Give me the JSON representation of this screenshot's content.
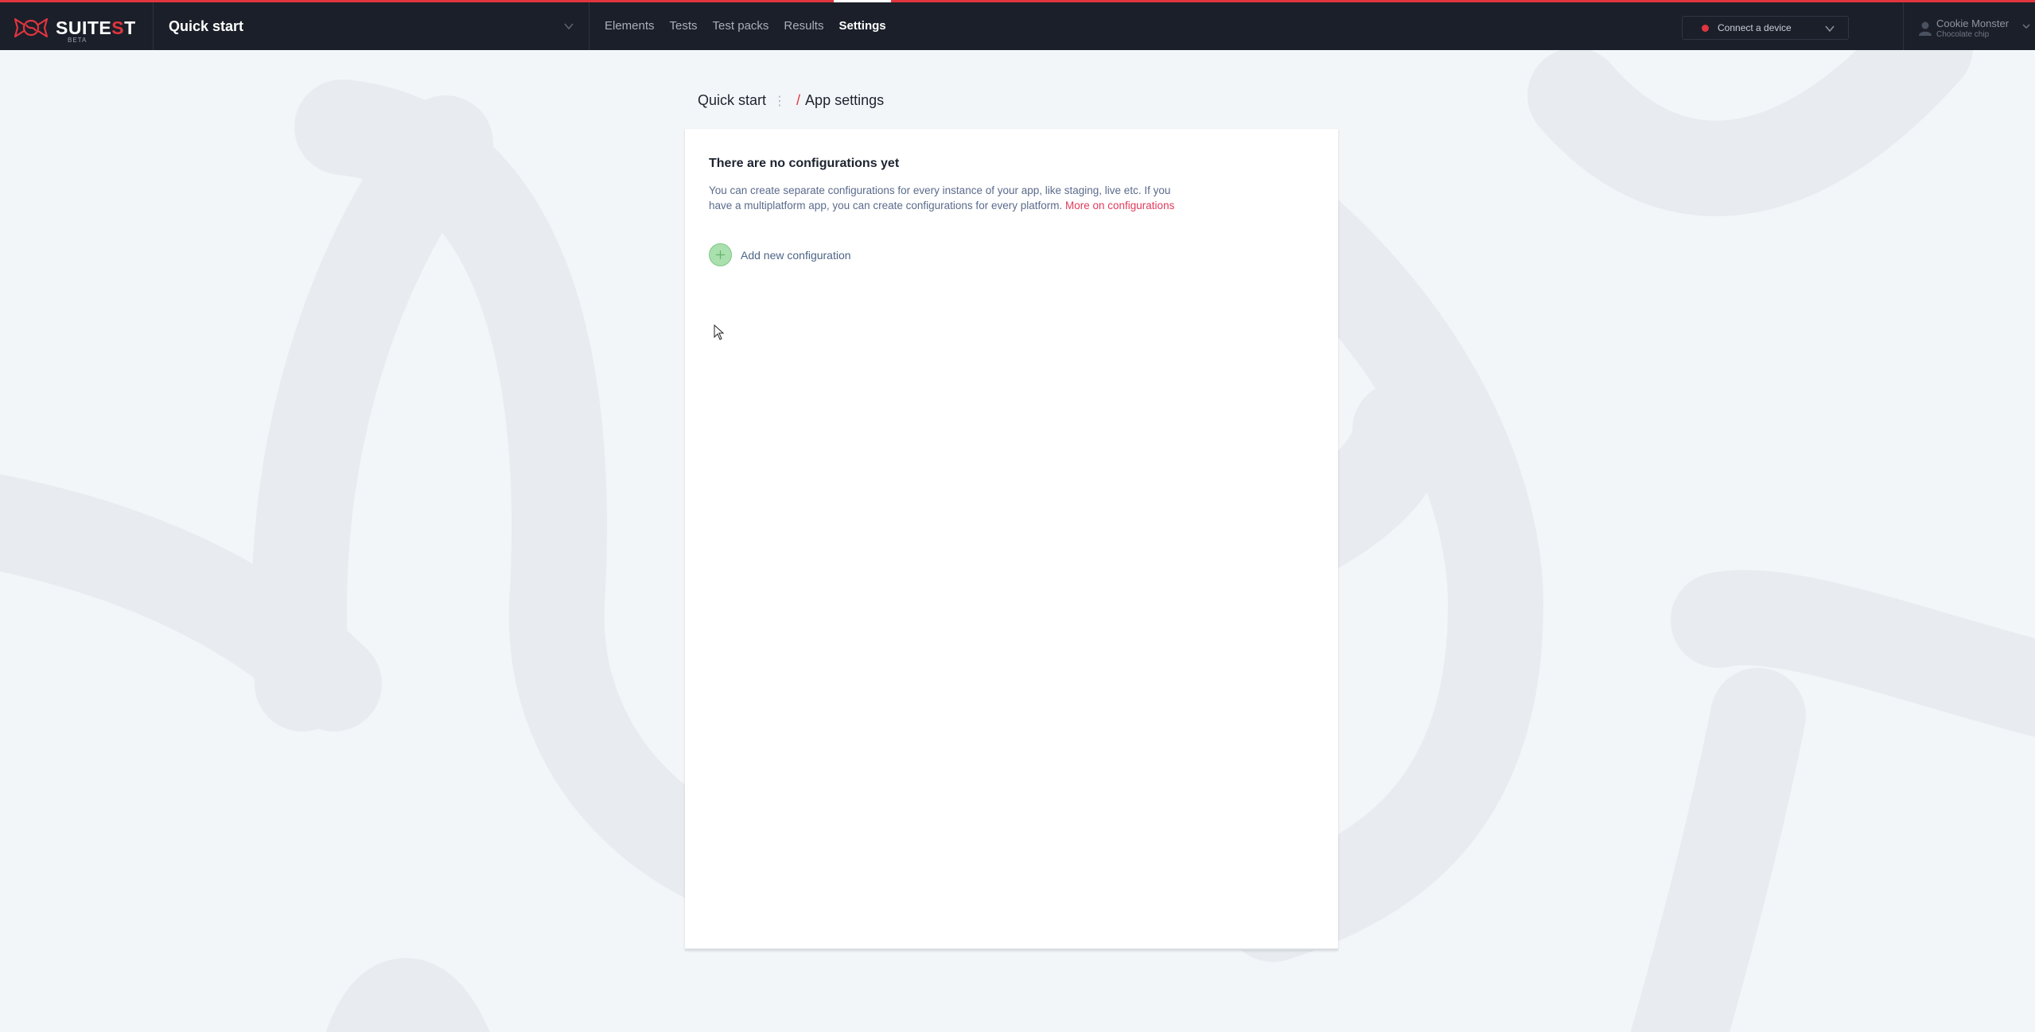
{
  "app": {
    "logo_text_left": "SUITE",
    "logo_text_x": "S",
    "logo_text_right": "T",
    "logo_badge": "BETA",
    "project_name": "Quick start"
  },
  "nav": {
    "items": [
      {
        "label": "Elements",
        "active": false
      },
      {
        "label": "Tests",
        "active": false
      },
      {
        "label": "Test packs",
        "active": false
      },
      {
        "label": "Results",
        "active": false
      },
      {
        "label": "Settings",
        "active": true
      }
    ]
  },
  "device": {
    "connect_label": "Connect a device",
    "status_color": "#e0353f"
  },
  "user": {
    "name": "Cookie Monster",
    "subtitle": "Chocolate chip"
  },
  "breadcrumb": {
    "root": "Quick start",
    "separator": "/",
    "current": "App settings"
  },
  "card": {
    "title": "There are no configurations yet",
    "description": "You can create separate configurations for every instance of your app, like staging, live etc. If you have a multiplatform app, you can create configurations for every platform.",
    "link_text": "More on configurations",
    "add_label": "Add new configuration"
  },
  "colors": {
    "accent": "#e0353f",
    "topbar": "#1b1f29",
    "link": "#e23a5c",
    "add_button": "#a9e0ad"
  },
  "icons": {
    "logo": "candy-logo-icon",
    "chevron": "chevron-down-icon",
    "status": "status-dot-icon",
    "avatar": "user-avatar-icon",
    "add": "plus-icon"
  }
}
